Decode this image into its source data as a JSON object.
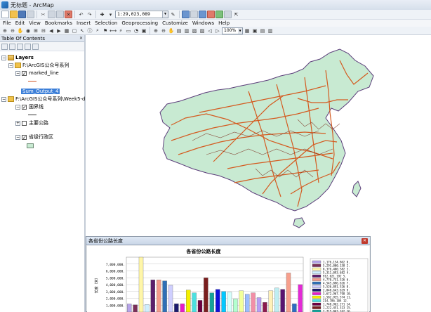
{
  "window": {
    "title": "无标题 - ArcMap"
  },
  "toolbar": {
    "scale": "1:29,023,089"
  },
  "menu": [
    "File",
    "Edit",
    "View",
    "Bookmarks",
    "Insert",
    "Selection",
    "Geoprocessing",
    "Customize",
    "Windows",
    "Help"
  ],
  "tools": {
    "zoom": "100%"
  },
  "toc": {
    "title": "Table Of Contents",
    "root": "Layers",
    "group1": "F:\\ArcGIS公众号系列",
    "layer_marked": "marked_line",
    "layer_selected": "Sum_Output_4",
    "group2": "F:\\ArcGIS公众号系列\\Week5-d",
    "layer_border": "国界线",
    "layer_roads": "主要公路",
    "layer_province": "省级行政区"
  },
  "graph_window": {
    "title": "各省份公路长度"
  },
  "chart_data": {
    "type": "bar",
    "title": "各省份公路长度",
    "ylabel": "长度（米）",
    "y_ticks": [
      "7,000,000.",
      "6,000,000.",
      "5,000,000.",
      "4,000,000.",
      "3,000,000.",
      "2,000,000.",
      "1,000,000."
    ],
    "ylim": [
      0,
      8000000
    ],
    "grid": true,
    "legend_position": "right",
    "values": [
      1176154,
      1050000,
      8300000,
      1100000,
      4700000,
      4700000,
      4545896,
      3900000,
      1200000,
      1200000,
      3200000,
      2800000,
      1700000,
      5000000,
      2800000,
      3300000,
      3000000,
      2900000,
      1900000,
      3100000,
      2600000,
      2800000,
      2100000,
      1400000,
      3100000,
      3500000,
      3300000,
      5700000,
      1200000,
      4000000
    ],
    "colors": [
      "#b6a3ea",
      "#7a2f5a",
      "#fff6a8",
      "#cfefff",
      "#5b1f6b",
      "#f39b8b",
      "#2f6fb6",
      "#cfcfff",
      "#1a1a6e",
      "#e81cc9",
      "#f4f000",
      "#4ce0e0",
      "#6c0040",
      "#7a1f1f",
      "#16a39a",
      "#1010d8",
      "#00c8ff",
      "#d4fffb",
      "#b3ffcf",
      "#f2ff99",
      "#9bbdff",
      "#f28fa7",
      "#b79ff5",
      "#8b1a4e",
      "#fff1b8",
      "#bfeef2",
      "#5a1470",
      "#f79f8c",
      "#2c6cc3",
      "#e32ad6"
    ],
    "legend_values": [
      "1,176,154.862 8.",
      "5,291,000.158 2.",
      "8,376,480.582 3.",
      "5,311,093.682 4.",
      "912,621.192 5.",
      "4,770,751.526 6.",
      "4,545,896.626 7.",
      "5,526,891.526 8.",
      "2,848,643.629 9.",
      "3,672,967.798 10.",
      "1,582,935.574 11.",
      "214,786.104 12.",
      "1,748,962.271 14.",
      "1,222,451.313 15.",
      "2,715,863.162 16."
    ],
    "legend_colors": [
      "#b6a3ea",
      "#7a2f5a",
      "#fff6a8",
      "#cfefff",
      "#5b1f6b",
      "#f39b8b",
      "#2f6fb6",
      "#cfcfff",
      "#1a1a6e",
      "#e81cc9",
      "#f4f000",
      "#4ce0e0",
      "#6c0040",
      "#7a1f1f",
      "#16a39a"
    ]
  }
}
